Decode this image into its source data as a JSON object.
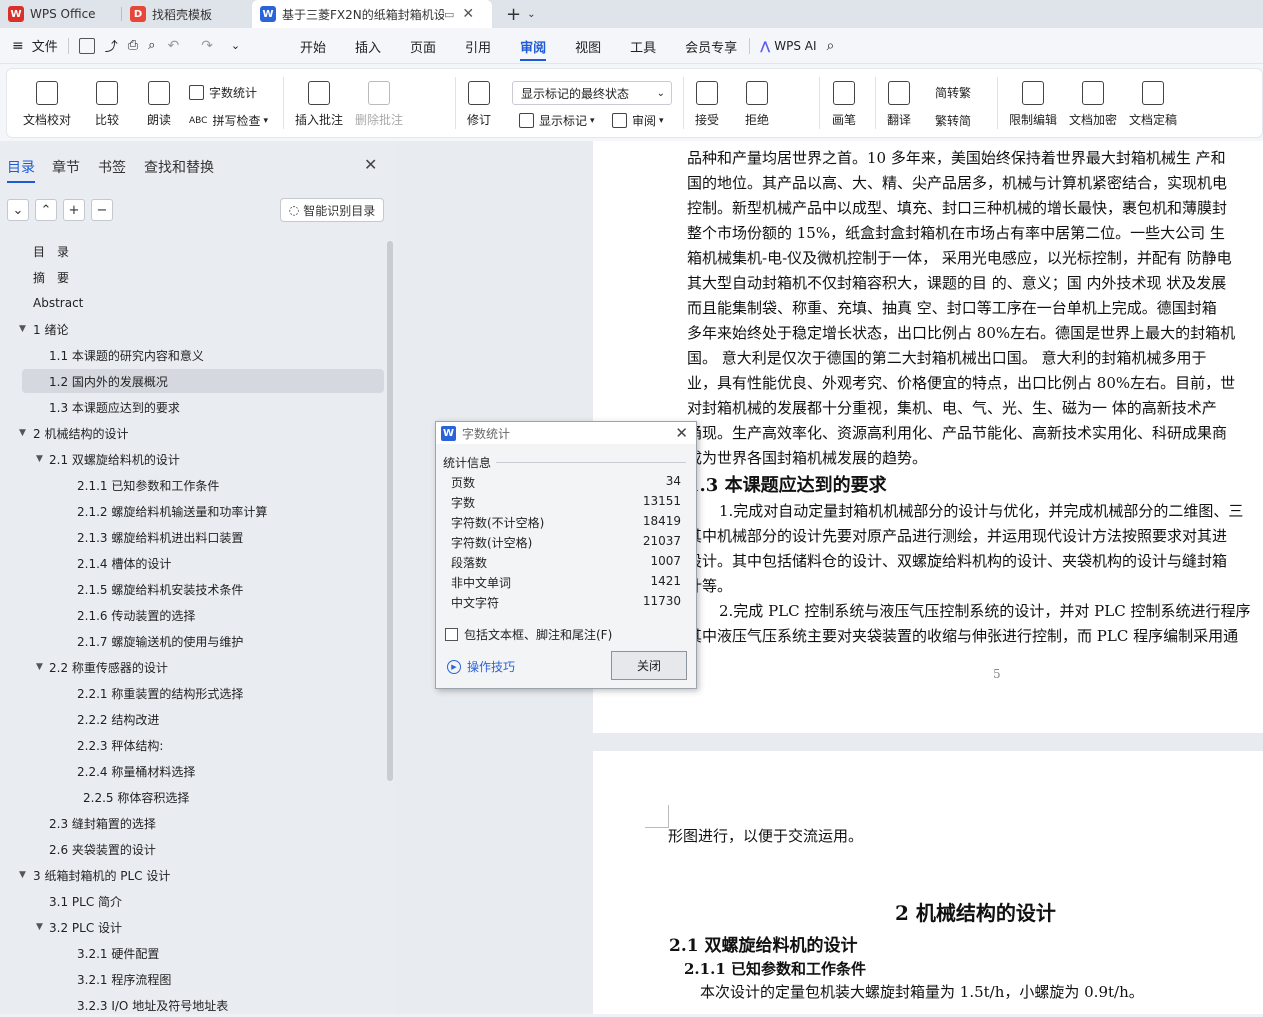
{
  "tabs": [
    {
      "label": "WPS Office",
      "logo": "W",
      "color": "#d9302c"
    },
    {
      "label": "找稻壳模板",
      "logo": "D",
      "color": "#e8463a"
    },
    {
      "label": "基于三菱FX2N的纸箱封箱机设",
      "logo": "W",
      "color": "#2b63d9"
    }
  ],
  "menubar": {
    "file": "文件",
    "items": [
      "开始",
      "插入",
      "页面",
      "引用",
      "审阅",
      "视图",
      "工具",
      "会员专享"
    ],
    "active": "审阅",
    "wps_ai": "WPS AI"
  },
  "ribbon": {
    "doc_check": "文档校对",
    "compare": "比较",
    "read_aloud": "朗读",
    "word_count": "字数统计",
    "spell_check": "拼写检查",
    "insert_comment": "插入批注",
    "delete_comment": "删除批注",
    "revise": "修订",
    "display_mode": "显示标记的最终状态",
    "show_markup": "显示标记",
    "review": "审阅",
    "accept": "接受",
    "reject": "拒绝",
    "pen": "画笔",
    "translate": "翻译",
    "to_traditional": "简转繁",
    "to_simplified": "繁转简",
    "restrict_edit": "限制编辑",
    "encrypt": "文档加密",
    "finalize": "文档定稿"
  },
  "leftpanel": {
    "tabs": [
      "目录",
      "章节",
      "书签",
      "查找和替换"
    ],
    "smart_toc": "智能识别目录",
    "toc": [
      {
        "text": "目　录",
        "level": 0
      },
      {
        "text": "摘　要",
        "level": 0
      },
      {
        "text": "Abstract",
        "level": 0
      },
      {
        "text": "1  绪论",
        "level": 1,
        "expand": true
      },
      {
        "text": "1.1  本课题的研究内容和意义",
        "level": 2
      },
      {
        "text": "1.2  国内外的发展概况",
        "level": 2,
        "selected": true
      },
      {
        "text": "1.3  本课题应达到的要求",
        "level": 2
      },
      {
        "text": "2  机械结构的设计",
        "level": 1,
        "expand": true
      },
      {
        "text": "2.1  双螺旋给料机的设计",
        "level": 2,
        "expand": true
      },
      {
        "text": "2.1.1  已知参数和工作条件",
        "level": 3
      },
      {
        "text": "2.1.2  螺旋给料机输送量和功率计算",
        "level": 3
      },
      {
        "text": "2.1.3  螺旋给料机进出料口装置",
        "level": 3
      },
      {
        "text": "2.1.4  槽体的设计",
        "level": 3
      },
      {
        "text": "2.1.5  螺旋给料机安装技术条件",
        "level": 3
      },
      {
        "text": "2.1.6  传动装置的选择",
        "level": 3
      },
      {
        "text": "2.1.7  螺旋输送机的使用与维护",
        "level": 3
      },
      {
        "text": "2.2  称重传感器的设计",
        "level": 2,
        "expand": true
      },
      {
        "text": "2.2.1  称重装置的结构形式选择",
        "level": 3
      },
      {
        "text": "2.2.2  结构改进",
        "level": 3
      },
      {
        "text": "2.2.3  秤体结构:",
        "level": 3
      },
      {
        "text": "2.2.4  称量桶材料选择",
        "level": 3
      },
      {
        "text": "2.2.5  称体容积选择",
        "level": 4
      },
      {
        "text": "2.3  缝封箱置的选择",
        "level": 2
      },
      {
        "text": "2.6  夹袋装置的设计",
        "level": 2
      },
      {
        "text": "3  纸箱封箱机的 PLC 设计",
        "level": 1,
        "expand": true
      },
      {
        "text": "3.1 PLC 简介",
        "level": 2
      },
      {
        "text": "3.2 PLC 设计",
        "level": 2,
        "expand": true
      },
      {
        "text": "3.2.1  硬件配置",
        "level": 3
      },
      {
        "text": "3.2.1  程序流程图",
        "level": 3
      },
      {
        "text": "3.2.3 I/O 地址及符号地址表",
        "level": 3
      }
    ]
  },
  "document": {
    "page1_lines": [
      "品种和产量均居世界之首。10 多年来，美国始终保持着世界最大封箱机械生  产和",
      "国的地位。其产品以高、大、精、尖产品居多，机械与计算机紧密结合，实现机电",
      "控制。新型机械产品中以成型、填充、封口三种机械的增长最快，裹包机和薄膜封",
      "整个市场份额的 15%，纸盒封盒封箱机在市场占有率中居第二位。一些大公司  生",
      "箱机械集机-电-仪及微机控制于一体，  采用光电感应，以光标控制，并配有  防静电",
      "其大型自动封箱机不仅封箱容积大，课题的目  的、意义；国  内外技术现  状及发展",
      "而且能集制袋、称重、充填、抽真  空、封口等工序在一台单机上完成。德国封箱",
      "多年来始终处于稳定增长状态，出口比例占 80%左右。德国是世界上最大的封箱机",
      "国。  意大利是仅次于德国的第二大封箱机械出口国。  意大利的封箱机械多用于",
      "业，具有性能优良、外观考究、价格便宜的特点，出口比例占 80%左右。目前，世",
      "对封箱机械的发展都十分重视，集机、电、气、光、生、磁为一  体的高新技术产",
      "涌现。生产高效率化、资源高利用化、产品节能化、高新技术实用化、科研成果商",
      "成为世界各国封箱机械发展的趋势。"
    ],
    "heading_1_3": "1.3  本课题应达到的要求",
    "para_1_3": [
      "1.完成对自动定量封箱机机械部分的设计与优化，并完成机械部分的二维图、三",
      "其中机械部分的设计先要对原产品进行测绘，并运用现代设计方法按照要求对其进",
      "设计。其中包括储料仓的设计、双螺旋给料机构的设计、夹袋机构的设计与缝封箱",
      "计等。",
      "2.完成 PLC 控制系统与液压气压控制系统的设计，并对 PLC 控制系统进行程序",
      "其中液压气压系统主要对夹袋装置的收缩与伸张进行控制，而 PLC 程序编制采用通"
    ],
    "page_number": "5",
    "page2_first": "形图进行，以便于交流运用。",
    "chapter2": "2  机械结构的设计",
    "heading_2_1": "2.1  双螺旋给料机的设计",
    "heading_2_1_1": "2.1.1  已知参数和工作条件",
    "para_2_1_1": "本次设计的定量包机装大螺旋封箱量为 1.5t/h，小螺旋为 0.9t/h。"
  },
  "dialog": {
    "title": "字数统计",
    "section": "统计信息",
    "stats": [
      {
        "label": "页数",
        "value": "34"
      },
      {
        "label": "字数",
        "value": "13151"
      },
      {
        "label": "字符数(不计空格)",
        "value": "18419"
      },
      {
        "label": "字符数(计空格)",
        "value": "21037"
      },
      {
        "label": "段落数",
        "value": "1007"
      },
      {
        "label": "非中文单词",
        "value": "1421"
      },
      {
        "label": "中文字符",
        "value": "11730"
      }
    ],
    "checkbox_label": "包括文本框、脚注和尾注(F)",
    "tips_link": "操作技巧",
    "close_button": "关闭"
  },
  "colors": {
    "accent": "#1f5bd6",
    "wps_red": "#d9302c"
  }
}
